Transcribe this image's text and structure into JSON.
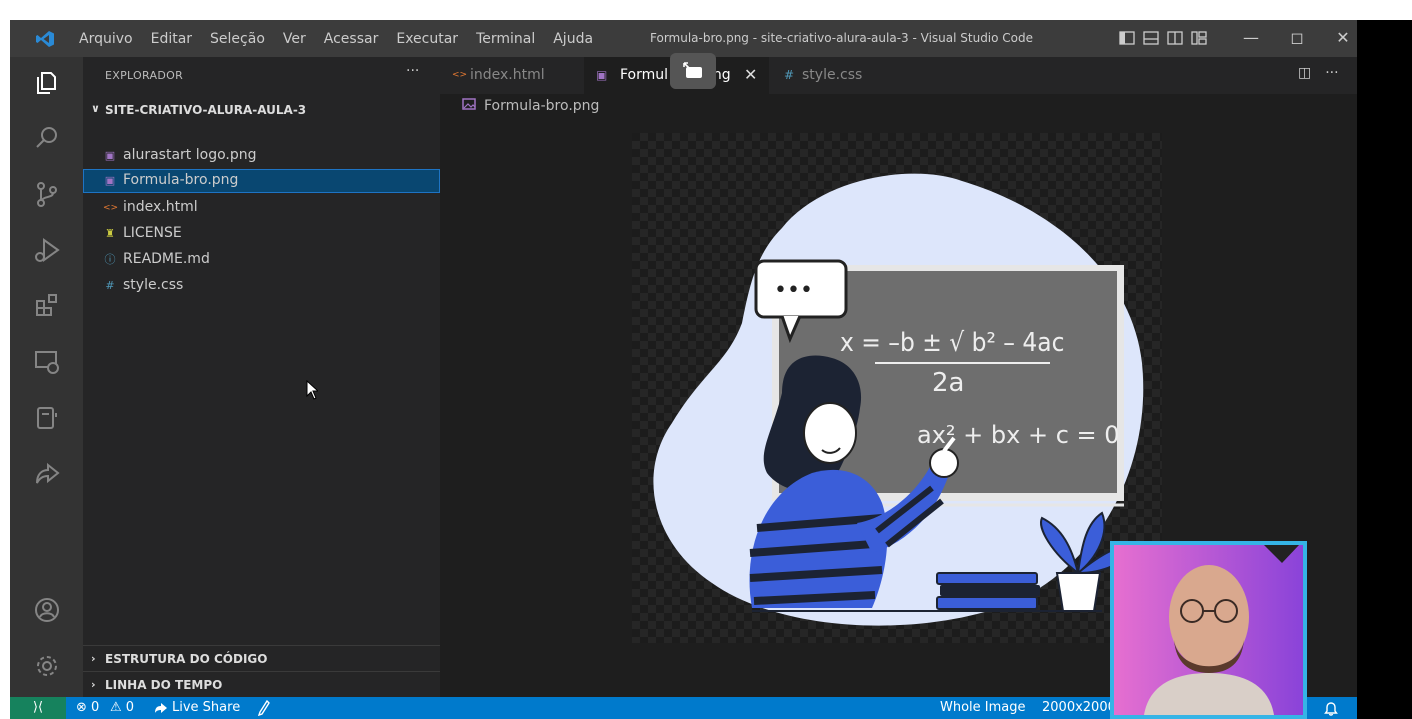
{
  "window": {
    "title": "Formula-bro.png - site-criativo-alura-aula-3 - Visual Studio Code",
    "menu": [
      "Arquivo",
      "Editar",
      "Seleção",
      "Ver",
      "Acessar",
      "Executar",
      "Terminal",
      "Ajuda"
    ],
    "controls": {
      "minimize": "—",
      "restore": "◻",
      "close": "✕"
    }
  },
  "activity_bar": {
    "icons": [
      "explorer-icon",
      "search-icon",
      "source-control-icon",
      "run-debug-icon",
      "extensions-icon",
      "remote-explorer-icon",
      "notebook-icon",
      "live-share-icon",
      "account-icon",
      "settings-gear-icon"
    ]
  },
  "sidebar": {
    "header": "EXPLORADOR",
    "more": "···",
    "project": "SITE-CRIATIVO-ALURA-AULA-3",
    "files": [
      {
        "name": "alurastart logo.png",
        "icon": "image-icon",
        "glyph": "▣",
        "color": "#a074c4"
      },
      {
        "name": "Formula-bro.png",
        "icon": "image-icon",
        "glyph": "▣",
        "color": "#a074c4"
      },
      {
        "name": "index.html",
        "icon": "html-icon",
        "glyph": "<>",
        "color": "#e37933"
      },
      {
        "name": "LICENSE",
        "icon": "license-icon",
        "glyph": "♜",
        "color": "#cbcb41"
      },
      {
        "name": "README.md",
        "icon": "info-icon",
        "glyph": "ⓘ",
        "color": "#519aba"
      },
      {
        "name": "style.css",
        "icon": "css-icon",
        "glyph": "#",
        "color": "#519aba"
      }
    ],
    "sections": [
      "ESTRUTURA DO CÓDIGO",
      "LINHA DO TEMPO"
    ]
  },
  "editor": {
    "tabs": [
      {
        "name": "index.html",
        "glyph": "<>",
        "color": "#e37933"
      },
      {
        "name": "Formula-bro.png",
        "shown": "Formul",
        "tail": "png",
        "glyph": "▣",
        "color": "#a074c4"
      },
      {
        "name": "style.css",
        "glyph": "#",
        "color": "#519aba"
      }
    ],
    "close_glyph": "✕",
    "actions": {
      "split": "◫",
      "more": "···"
    },
    "breadcrumb": "Formula-bro.png",
    "formula_main": "x = –b ± √ b² – 4ac",
    "formula_denominator": "2a",
    "formula_equation": "ax² + bx + c = 0",
    "speech_bubble": "•••"
  },
  "status_bar": {
    "remote_glyph": "⟩⟨",
    "errors": "⊗ 0",
    "warnings": "⚠ 0",
    "live_share": "Live Share",
    "zoom_mode": "Whole Image",
    "image_size": "2000x2000",
    "bell": "🔔"
  },
  "colors": {
    "accent": "#007acc",
    "selection": "#094771",
    "illustration_blue": "#3b5ed9",
    "blob": "#dde6fb"
  }
}
